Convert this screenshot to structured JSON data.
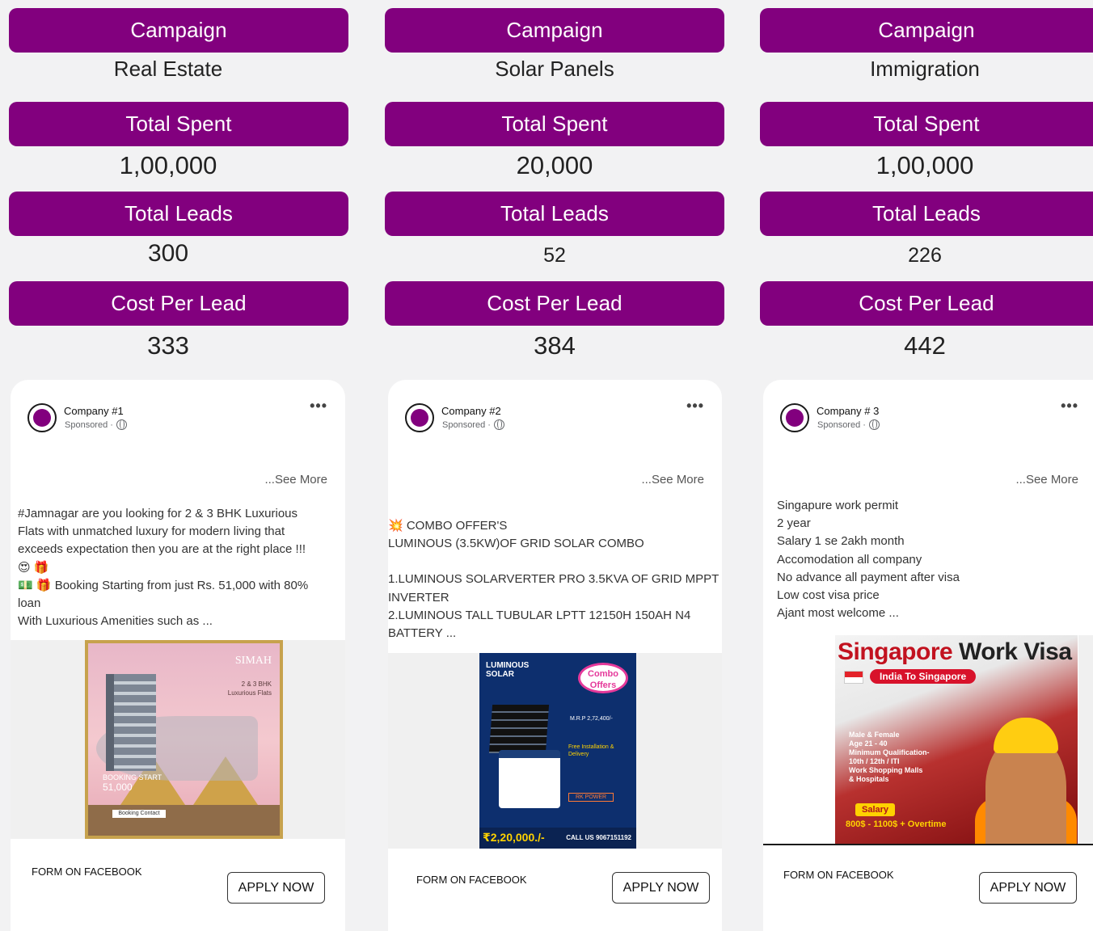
{
  "labels": {
    "campaign": "Campaign",
    "total_spent": "Total Spent",
    "total_leads": "Total Leads",
    "cost_per_lead": "Cost Per Lead",
    "see_more": "...See More",
    "sponsored": "Sponsored ·",
    "form": "FORM ON FACEBOOK",
    "apply": "APPLY NOW",
    "more": "•••"
  },
  "columns": [
    {
      "campaign": "Real Estate",
      "total_spent": "1,00,000",
      "total_leads": "300",
      "cost_per_lead": "333",
      "company": "Company #1",
      "post_lines": [
        "#Jamnagar are you looking for 2 & 3 BHK Luxurious",
        "Flats with unmatched luxury for modern living that",
        "exceeds expectation then you are at the right place !!!",
        "😍 🎁",
        "💵 🎁 Booking Starting from just Rs. 51,000 with 80%",
        "loan",
        "With Luxurious Amenities such as ..."
      ],
      "creative": {
        "brand": "SIMAH",
        "line1": "2 & 3 BHK",
        "line2": "Luxurious Flats",
        "booking": "BOOKING START",
        "amount": "51,000",
        "contact": "Booking Contact"
      }
    },
    {
      "campaign": "Solar Panels",
      "total_spent": "20,000",
      "total_leads": "52",
      "cost_per_lead": "384",
      "company": "Company #2",
      "post_lines": [
        "💥 COMBO OFFER'S",
        "LUMINOUS (3.5KW)OF GRID SOLAR COMBO",
        "",
        "1.LUMINOUS SOLARVERTER PRO 3.5KVA OF GRID MPPT",
        "INVERTER",
        "2.LUMINOUS TALL TUBULAR LPTT 12150H 150AH N4",
        "BATTERY ..."
      ],
      "creative": {
        "logo1": "LUMINOUS",
        "logo2": "SOLAR",
        "badge1": "Combo",
        "badge2": "Offers",
        "mrp": "M.R.P 2,72,400/-",
        "install": "Free Installation & Delivery",
        "rk": "RK POWER",
        "price": "₹2,20,000./-",
        "call": "CALL US 9067151192"
      }
    },
    {
      "campaign": "Immigration",
      "total_spent": "1,00,000",
      "total_leads": "226",
      "cost_per_lead": "442",
      "company": "Company # 3",
      "post_lines": [
        "Singapure work permit",
        "2 year",
        "Salary 1 se 2akh month",
        "Accomodation all company",
        "No advance all payment after visa",
        "Low cost visa price",
        "Ajant most welcome ..."
      ],
      "creative": {
        "head_red": "Singapore",
        "head_dark": " Work Visa",
        "sub": "India To Singapore",
        "points": [
          "Male & Female",
          "Age 21 - 40",
          "Minimum Qualification-",
          "10th / 12th / ITI",
          "Work Shopping Malls",
          "& Hospitals"
        ],
        "salary": "Salary",
        "overtime": "800$ - 1100$ + Overtime"
      }
    }
  ],
  "colors": {
    "accent": "#82007e",
    "background": "#f2f2f3",
    "card": "#ffffff"
  }
}
